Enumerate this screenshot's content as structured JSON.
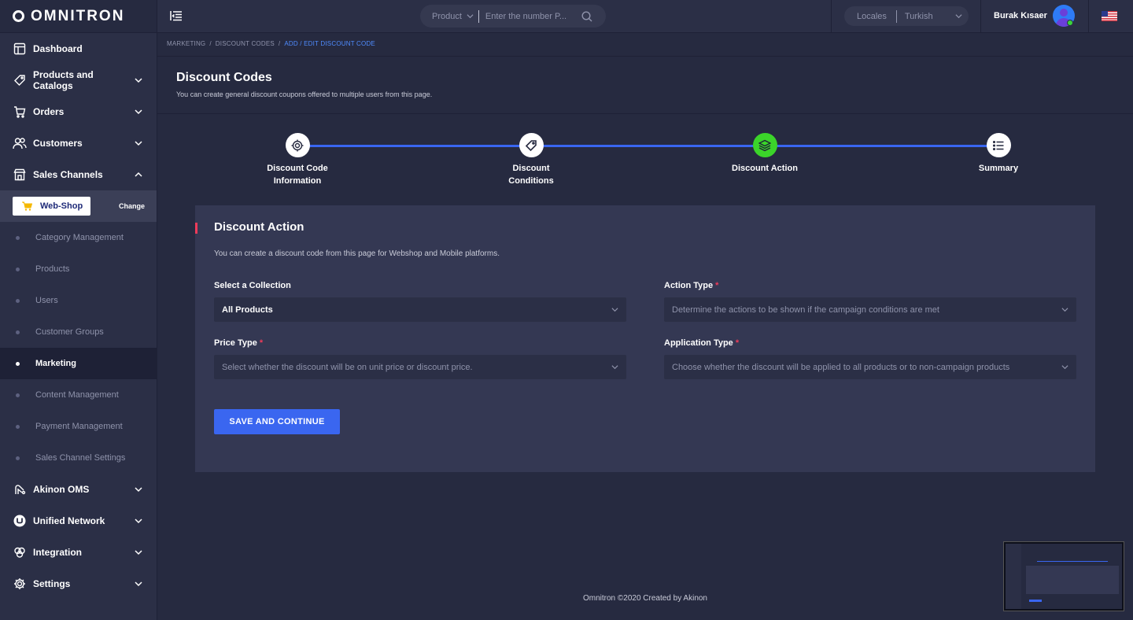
{
  "brand": {
    "name": "OMNITRON"
  },
  "sidebar": {
    "items": [
      {
        "label": "Dashboard",
        "icon": "dashboard-icon"
      },
      {
        "label": "Products and Catalogs",
        "icon": "tag-icon"
      },
      {
        "label": "Orders",
        "icon": "cart-icon"
      },
      {
        "label": "Customers",
        "icon": "users-icon"
      },
      {
        "label": "Sales Channels",
        "icon": "store-icon"
      }
    ],
    "channel": {
      "label": "Web-Shop",
      "change": "Change"
    },
    "sub_items": [
      "Category Management",
      "Products",
      "Users",
      "Customer Groups",
      "Marketing",
      "Content Management",
      "Payment Management",
      "Sales Channel Settings"
    ],
    "bottom_items": [
      {
        "label": "Akinon OMS",
        "icon": "oms-icon"
      },
      {
        "label": "Unified Network",
        "icon": "network-icon"
      },
      {
        "label": "Integration",
        "icon": "integration-icon"
      },
      {
        "label": "Settings",
        "icon": "gear-icon"
      }
    ]
  },
  "header": {
    "search_category": "Product",
    "search_placeholder": "Enter the number P...",
    "locales_label": "Locales",
    "locale_value": "Turkish",
    "user_name": "Burak Kısaer"
  },
  "breadcrumb": {
    "items": [
      "MARKETING",
      "/",
      "DISCOUNT CODES",
      "/"
    ],
    "current": "ADD / EDIT DISCOUNT CODE"
  },
  "page": {
    "title": "Discount Codes",
    "subtitle": "You can create general discount coupons offered to multiple users from this page."
  },
  "stepper": {
    "steps": [
      {
        "label_line1": "Discount Code",
        "label_line2": "Information"
      },
      {
        "label_line1": "Discount",
        "label_line2": "Conditions"
      },
      {
        "label_line1": "Discount Action",
        "label_line2": ""
      },
      {
        "label_line1": "Summary",
        "label_line2": ""
      }
    ]
  },
  "card": {
    "title": "Discount Action",
    "description": "You can create a discount code from this page for Webshop and Mobile platforms.",
    "fields": {
      "collection": {
        "label": "Select a Collection",
        "value": "All Products"
      },
      "action_type": {
        "label": "Action Type",
        "required": "*",
        "placeholder": "Determine the actions to be shown if the campaign conditions are met"
      },
      "price_type": {
        "label": "Price Type",
        "required": "*",
        "placeholder": "Select whether the discount will be on unit price or discount price."
      },
      "application_type": {
        "label": "Application Type",
        "required": "*",
        "placeholder": "Choose whether the discount will be applied to all products or to non-campaign products"
      }
    },
    "save_label": "SAVE AND CONTINUE"
  },
  "footer": {
    "text": "Omnitron ©2020 Created by Akinon"
  },
  "colors": {
    "accent": "#3a66f0",
    "active_step": "#3bd42a",
    "required": "#ee3b5a"
  }
}
